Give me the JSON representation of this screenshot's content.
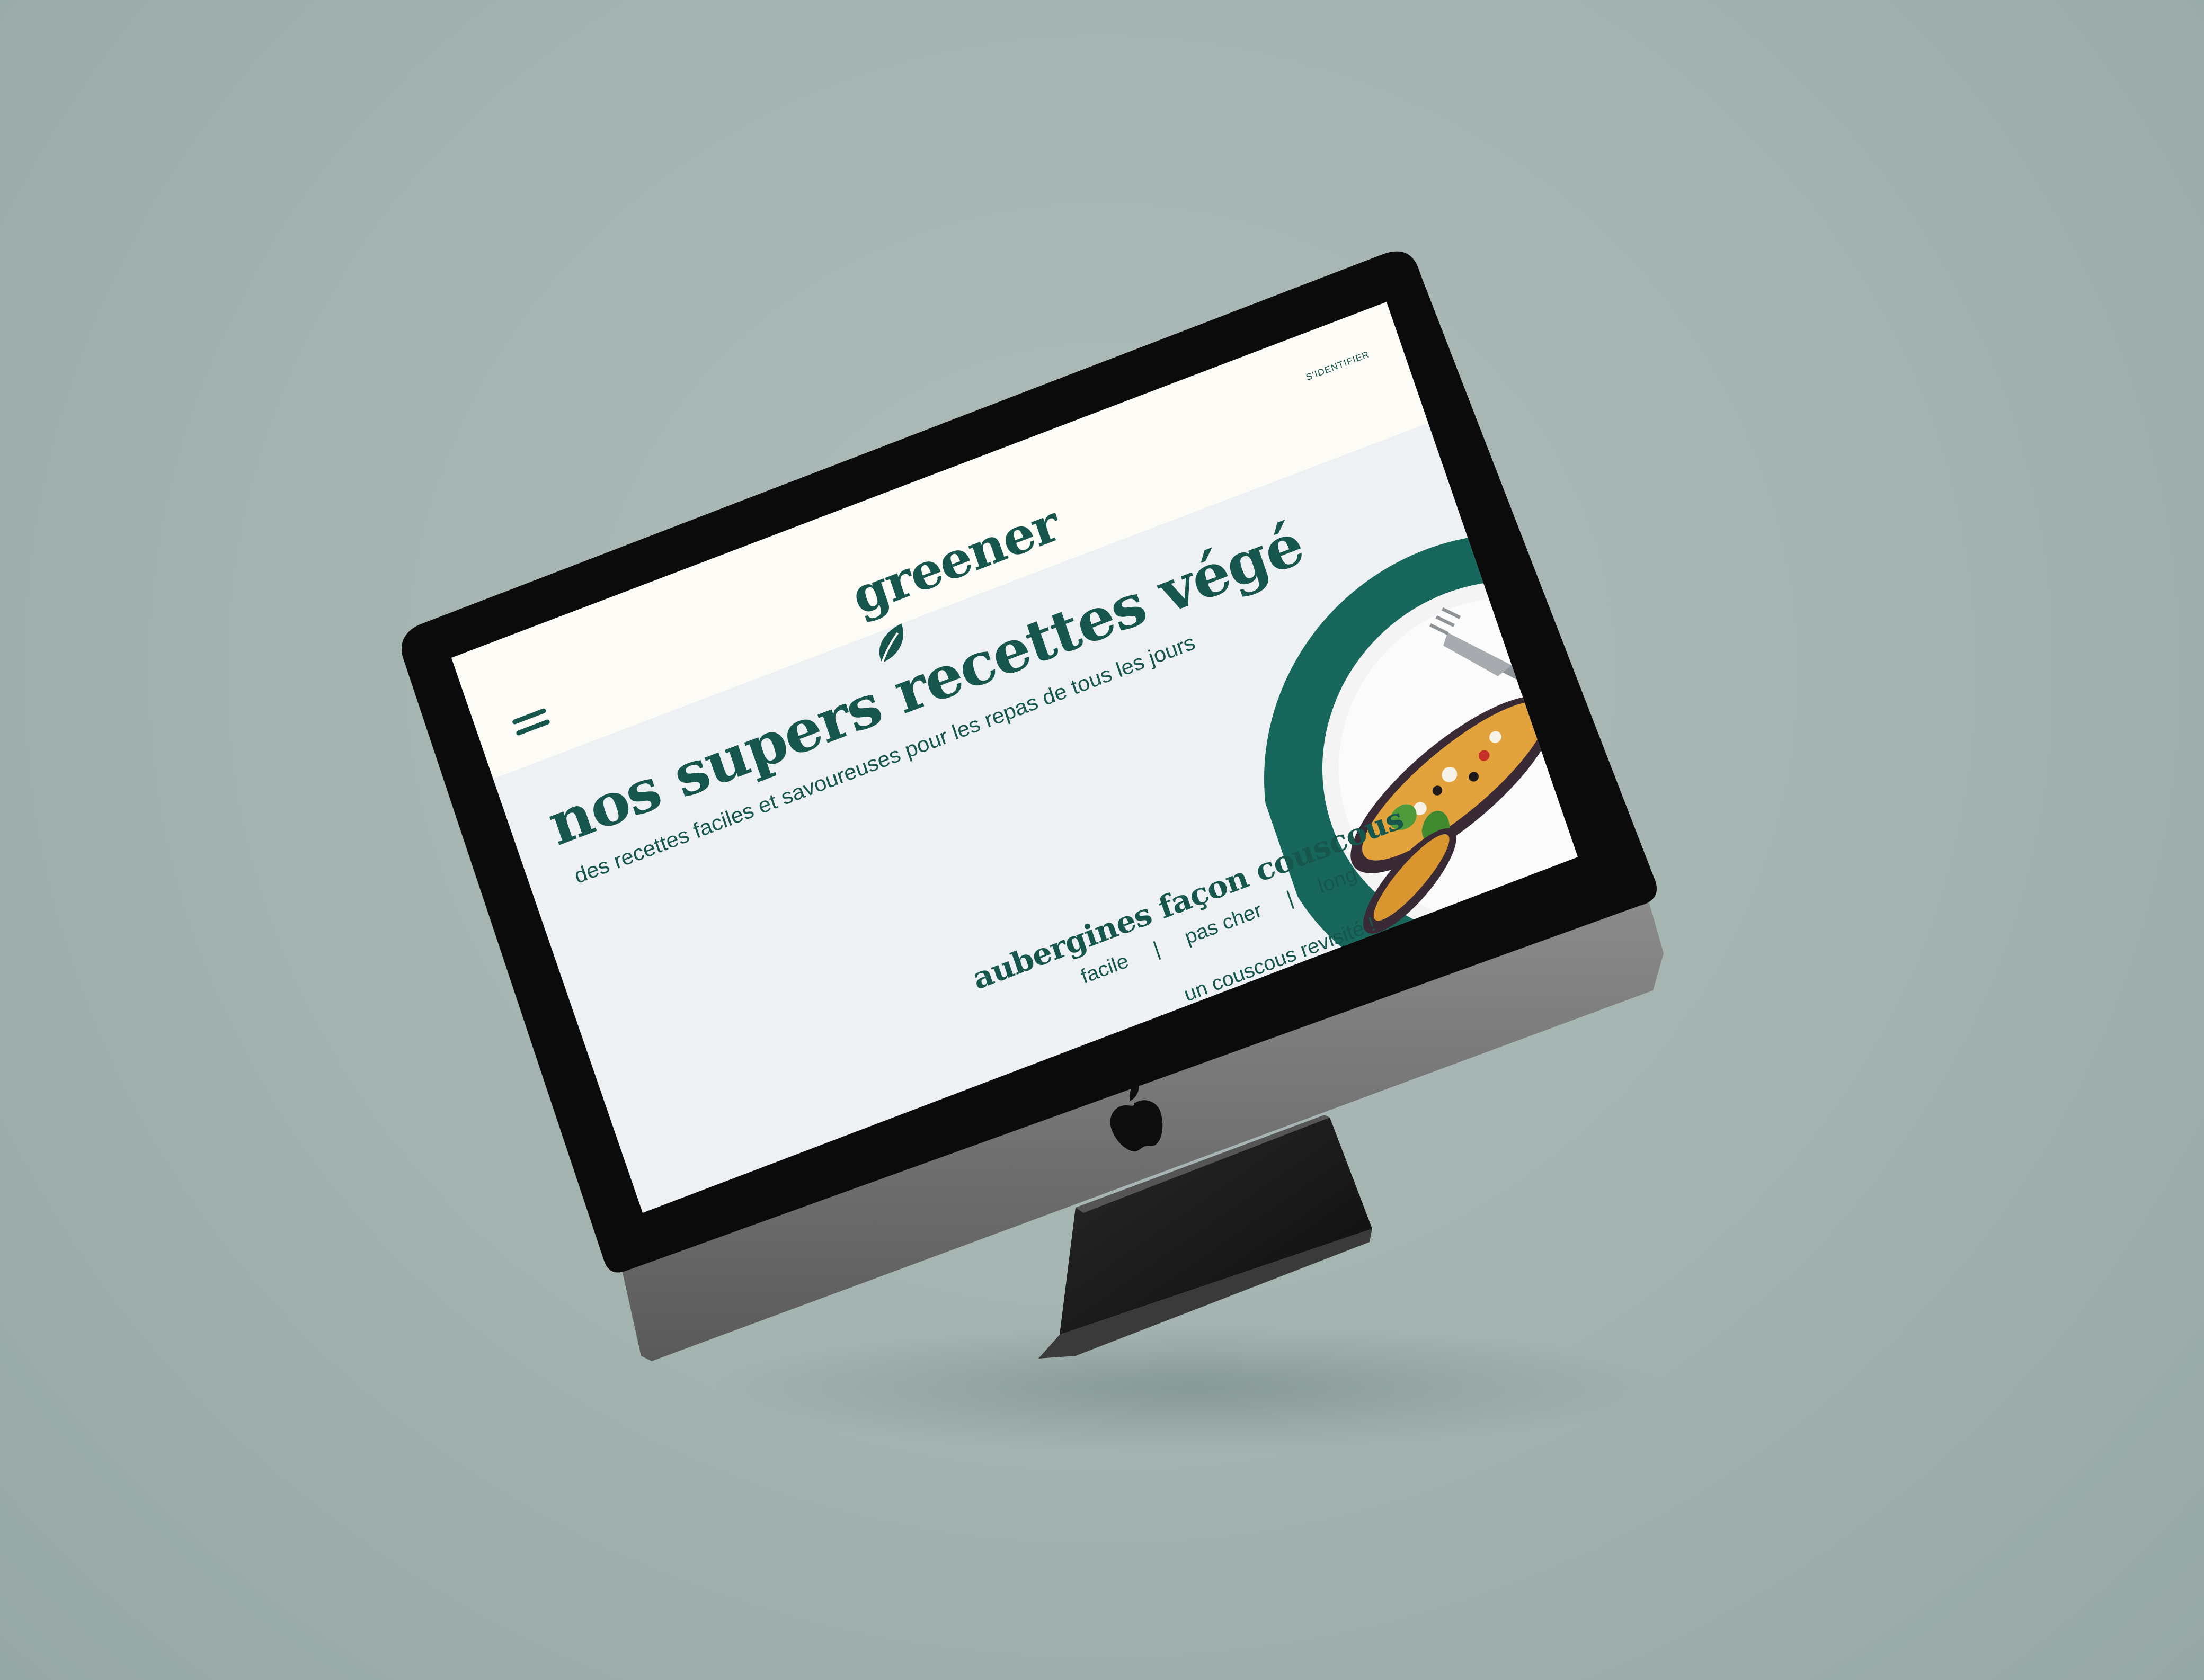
{
  "header": {
    "login_label": "S'IDENTIFIER",
    "logo_text": "greener"
  },
  "hero": {
    "title": "nos supers recettes végé",
    "subtitle": "des recettes faciles et savoureuses pour les repas de tous les jours"
  },
  "recipe": {
    "title": "aubergines façon couscous",
    "tags": [
      "facile",
      "pas cher",
      "long"
    ],
    "separator": "|",
    "description": "un couscous revisité !"
  },
  "colors": {
    "brand_green": "#16564c",
    "circle_green": "#17675c",
    "screen_bg": "#edf1f4",
    "header_bg": "#fdfbf5",
    "backdrop": "#a3b3b0"
  },
  "icons": {
    "menu": "hamburger-icon",
    "logo_leaf": "leaf-icon",
    "device_logo": "apple-logo-icon"
  }
}
